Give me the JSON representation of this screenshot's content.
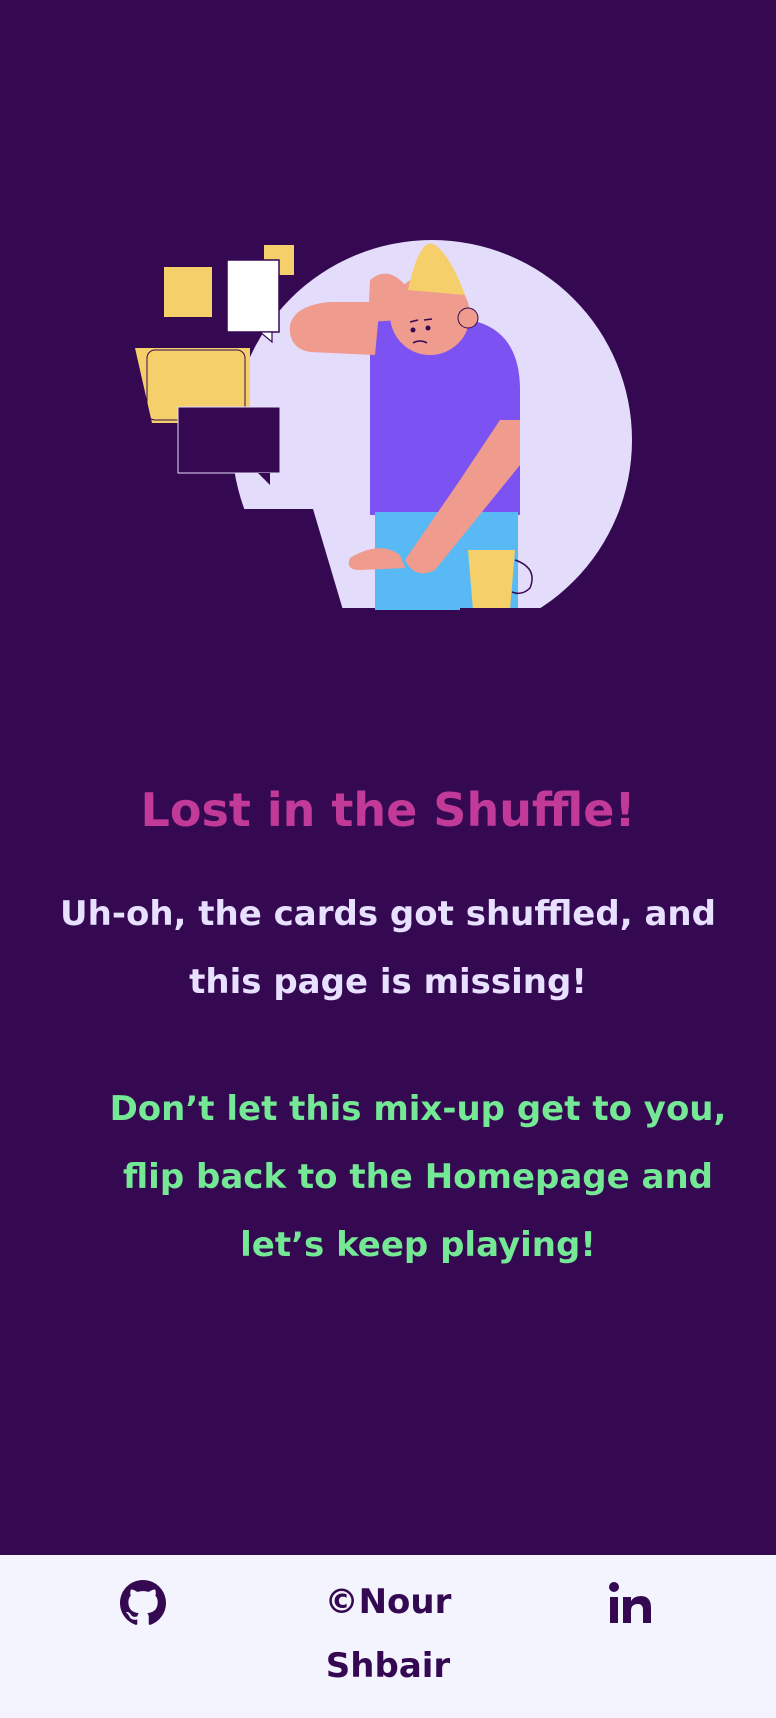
{
  "main": {
    "title": "Lost in the Shuffle!",
    "subtitle": "Uh-oh, the cards got shuffled, and this page is missing!",
    "cta": "Don’t let this mix-up get to you, flip back to the Homepage and let’s keep playing!"
  },
  "footer": {
    "copyright": "©Nour Shbair",
    "github_icon": "github-icon",
    "linkedin_icon": "linkedin-icon"
  },
  "colors": {
    "background": "#350852",
    "title": "#c23a97",
    "subtitle": "#e8e0ff",
    "cta": "#74e895",
    "footer_bg": "#f4f4fe",
    "footer_text": "#350852"
  }
}
